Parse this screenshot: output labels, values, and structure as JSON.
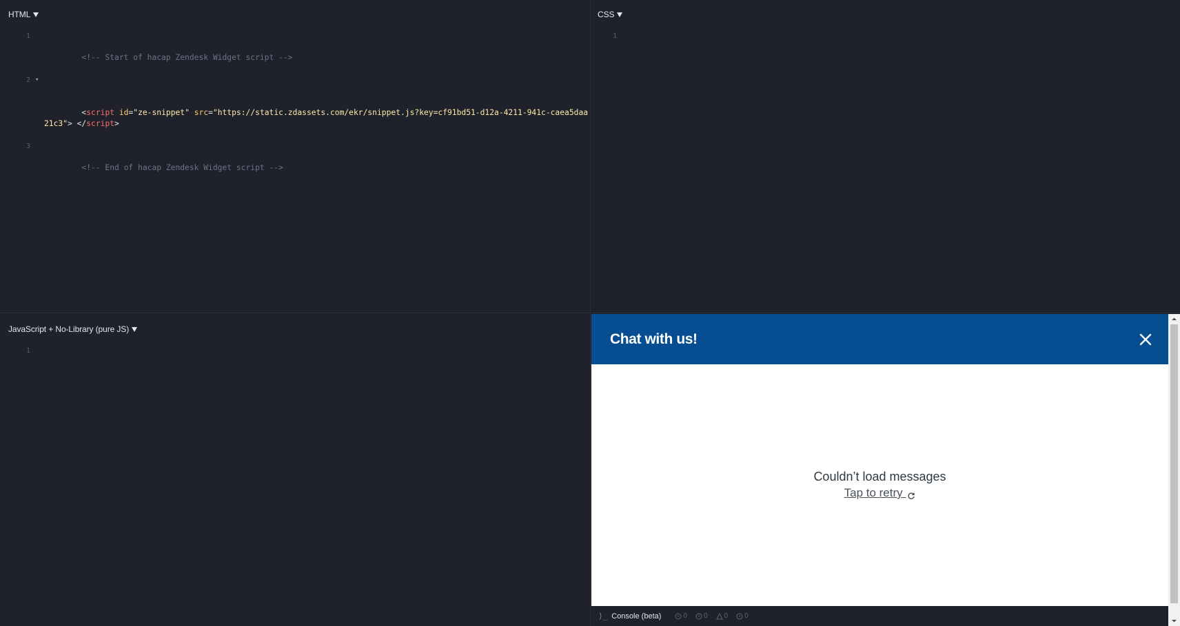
{
  "colors": {
    "editor_bg": "#1f222a",
    "chat_header": "#064e91",
    "comment": "#6a7389",
    "tag": "#ff6e62",
    "attr": "#ffcc66",
    "string": "#ffe9a8"
  },
  "panes": {
    "html": {
      "label": "HTML"
    },
    "css": {
      "label": "CSS"
    },
    "js": {
      "label": "JavaScript + No-Library (pure JS)"
    }
  },
  "html_code": {
    "line1_no": "1",
    "line1_comment": "<!-- Start of hacap Zendesk Widget script -->",
    "line2_no": "2",
    "line2_open": "<",
    "line2_tag": "script",
    "line2_attr1": "id",
    "line2_eq1": "=",
    "line2_val1": "\"ze-snippet\"",
    "line2_attr2": "src",
    "line2_eq2": "=",
    "line2_val2": "\"https://static.zdassets.com/ekr/snippet.js?key=cf91bd51-d12a-4211-941c-caea5daa21c3\"",
    "line2_close1": "> </",
    "line2_tag_close": "script",
    "line2_close2": ">",
    "line3_no": "3",
    "line3_comment": "<!-- End of hacap Zendesk Widget script -->"
  },
  "css_code": {
    "line1_no": "1"
  },
  "js_code": {
    "line1_no": "1"
  },
  "chat": {
    "title": "Chat with us!",
    "close_icon": "close-icon",
    "error_title": "Couldn’t load messages",
    "retry_label": "Tap to retry ",
    "retry_icon": "refresh-icon"
  },
  "console": {
    "prompt": "⟩_",
    "label": "Console (beta)",
    "counts": [
      {
        "icon": "info-icon",
        "value": "0"
      },
      {
        "icon": "info-icon",
        "value": "0"
      },
      {
        "icon": "warning-icon",
        "value": "0"
      },
      {
        "icon": "error-icon",
        "value": "0"
      }
    ]
  }
}
